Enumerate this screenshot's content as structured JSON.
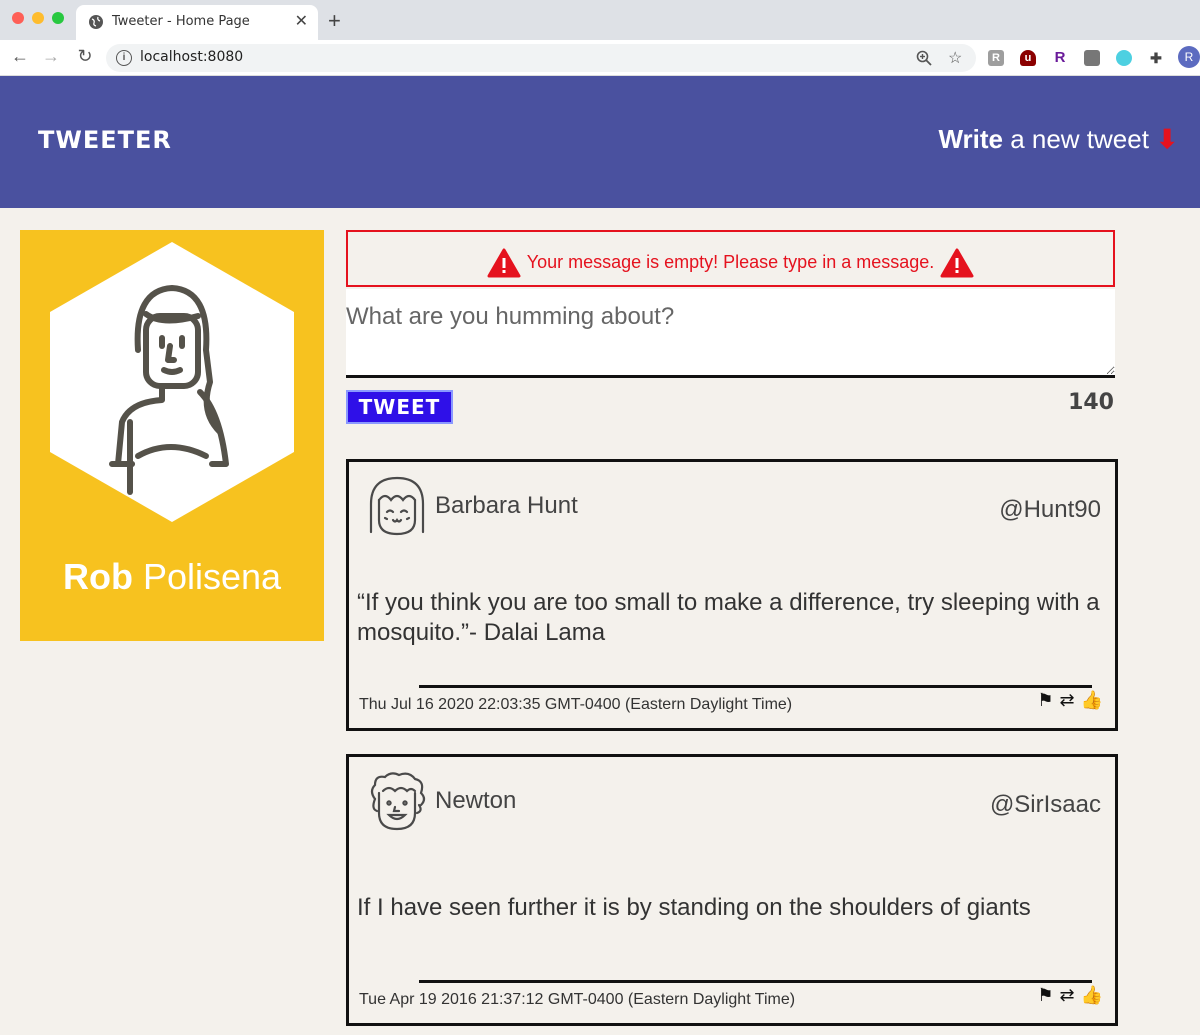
{
  "browser": {
    "tab_title": "Tweeter - Home Page",
    "tab_close": "✕",
    "new_tab": "+",
    "url": "localhost:8080",
    "nav_back": "←",
    "nav_forward": "→",
    "nav_reload": "↻",
    "profile_initial": "R"
  },
  "header": {
    "logo": "TWEETER",
    "write_bold": "Write",
    "write_rest": " a new tweet",
    "write_arrow": "⬇"
  },
  "profile": {
    "first_name": "Rob",
    "last_name": " Polisena"
  },
  "compose": {
    "error_message": "Your message is empty!  Please type in a message.",
    "placeholder": "What are you humming about?",
    "tweet_button": "TWEET",
    "counter": "140"
  },
  "tweets": [
    {
      "name": "Barbara Hunt",
      "handle": "@Hunt90",
      "text": "“If you think you are too small to make a difference, try sleeping with a mosquito.”- Dalai Lama",
      "date": "Thu Jul 16 2020 22:03:35 GMT-0400 (Eastern Daylight Time)"
    },
    {
      "name": "Newton",
      "handle": "@SirIsaac",
      "text": "If I have seen further it is by standing on the shoulders of giants",
      "date": "Tue Apr 19 2016 21:37:12 GMT-0400 (Eastern Daylight Time)"
    }
  ],
  "icons": {
    "flag": "⚑",
    "retweet": "⇄",
    "like": "👍"
  },
  "colors": {
    "header_bg": "#4a519f",
    "profile_bg": "#f7c21f",
    "error_red": "#e5121e",
    "tweet_button_bg": "#2f10e8",
    "page_bg": "#f4f1ec"
  }
}
